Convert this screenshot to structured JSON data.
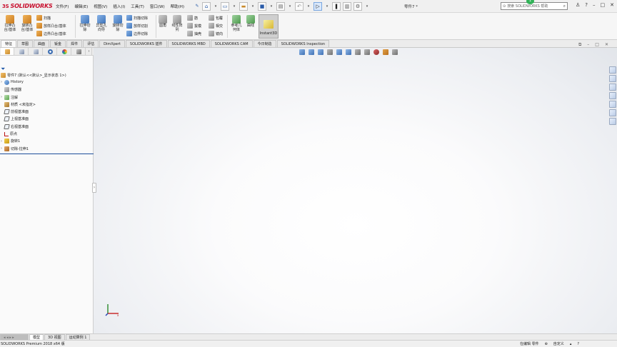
{
  "app": {
    "logo_prefix": "3S",
    "logo_text": "SOLIDWORKS",
    "document_title": "零件7 *"
  },
  "menu": [
    "文件(F)",
    "编辑(E)",
    "视图(V)",
    "插入(I)",
    "工具(T)",
    "窗口(W)",
    "帮助(H)"
  ],
  "search": {
    "placeholder": "搜索 SOLIDWORKS 帮助"
  },
  "notification_count": "1",
  "ribbon": {
    "extrude_boss": "拉伸凸\n台/基体",
    "revolve_boss": "旋转凸\n台/基体",
    "sweep": "扫描",
    "loft_boss": "放样凸台/基体",
    "boundary_boss": "边界凸台/基体",
    "extrude_cut": "拉伸切\n除",
    "hole_wizard": "异型孔\n向导",
    "revolve_cut": "旋转切\n除",
    "swept_cut": "扫描切除",
    "lofted_cut": "放样切割",
    "boundary_cut": "边界切除",
    "fillet": "圆角",
    "linear_pattern": "线性阵\n列",
    "rib": "筋",
    "draft": "拔模",
    "shell": "抽壳",
    "wrap": "包覆",
    "intersect": "相交",
    "mirror": "镜向",
    "reference_geometry": "参考几\n何体",
    "curves": "曲线",
    "instant3d": "Instant3D"
  },
  "command_tabs": [
    "特征",
    "草图",
    "曲面",
    "钣金",
    "焊件",
    "评估",
    "DimXpert",
    "SOLIDWORKS 插件",
    "SOLIDWORKS MBD",
    "SOLIDWORKS CAM",
    "今日制造",
    "SOLIDWORKS Inspection"
  ],
  "feature_tree": {
    "root": "零件7 (默认<<默认>_显示状态 1>)",
    "items": [
      {
        "label": "History",
        "icon": "history-icon"
      },
      {
        "label": "传感器",
        "icon": "sensors-icon"
      },
      {
        "label": "注解",
        "icon": "annotations-icon"
      },
      {
        "label": "材质 <未指定>",
        "icon": "material-icon"
      },
      {
        "label": "前视基准面",
        "icon": "plane-icon"
      },
      {
        "label": "上视基准面",
        "icon": "plane-icon"
      },
      {
        "label": "右视基准面",
        "icon": "plane-icon"
      },
      {
        "label": "原点",
        "icon": "origin-icon"
      },
      {
        "label": "旋转1",
        "icon": "revolve-feature-icon"
      },
      {
        "label": "切除-拉伸1",
        "icon": "cut-extrude-feature-icon"
      }
    ]
  },
  "bottom_tabs": [
    "模型",
    "3D 视图",
    "运动算例 1"
  ],
  "status": {
    "version": "SOLIDWORKS Premium 2018 x64 版",
    "editing": "在编辑 零件",
    "units": "自定义"
  }
}
